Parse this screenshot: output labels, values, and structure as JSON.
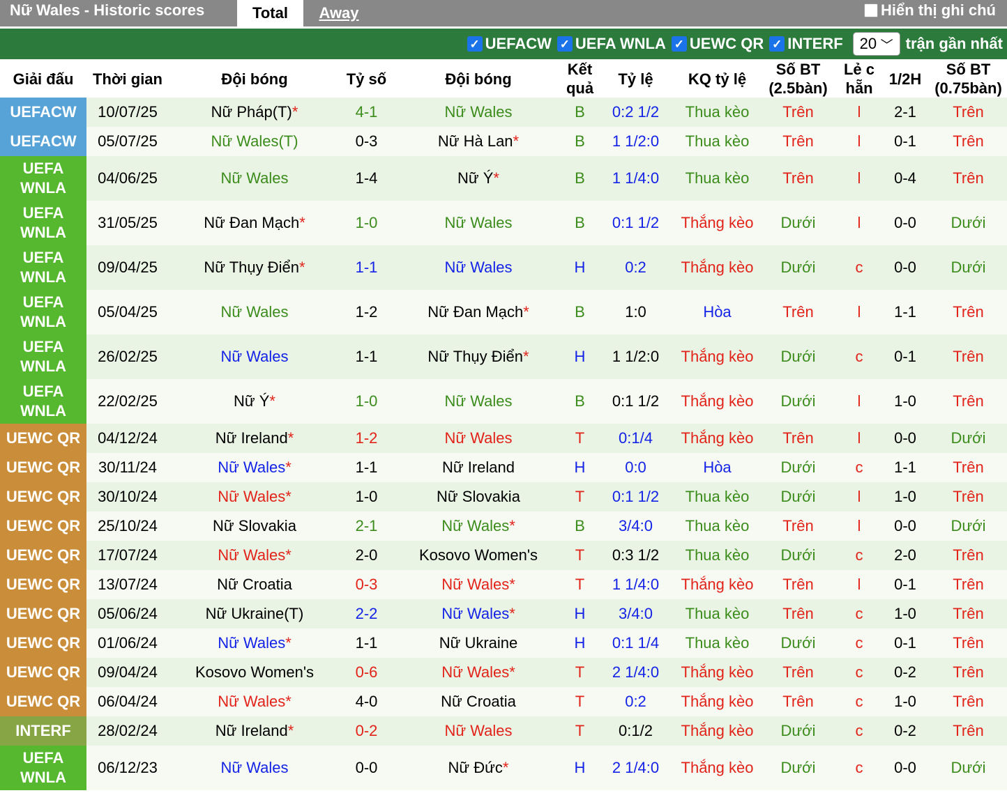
{
  "header": {
    "title": "Nữ Wales - Historic scores",
    "tab_total": "Total",
    "tab_away": "Away",
    "note_label": "Hiển thị ghi chú"
  },
  "filters": {
    "items": [
      "UEFACW",
      "UEFA WNLA",
      "UEWC QR",
      "INTERF"
    ],
    "count_value": "20",
    "count_suffix": "trận gần nhất"
  },
  "columns": [
    "Giải đấu",
    "Thời gian",
    "Đội bóng",
    "Tỷ số",
    "Đội bóng",
    "Kết quả",
    "Tỷ lệ",
    "KQ tỷ lệ",
    "Số BT (2.5bàn)",
    "Lẻ c hẵn",
    "1/2H",
    "Số BT (0.75bàn)"
  ],
  "colors": {
    "red": "#e2231a",
    "green": "#3c8c1c",
    "blue": "#1423e6",
    "black": "#000000",
    "uefacw": "#57a2d6",
    "wnla": "#55b82e",
    "uewc": "#ca8e3a",
    "interf": "#87a544"
  },
  "rows": [
    {
      "comp": "UEFACW",
      "ct": "uefacw",
      "date": "10/07/25",
      "home": "Nữ Pháp(T)",
      "hs": true,
      "hc": "black",
      "score": "4-1",
      "ac": "green",
      "away": "Nữ Wales",
      "as": false,
      "res": "B",
      "rc": "green",
      "odds": "0:2 1/2",
      "oc": "blue",
      "ko": "Thua kèo",
      "kc": "green",
      "ou": "Trên",
      "uc": "red",
      "oe": "l",
      "h2": "2-1",
      "ou2": "Trên",
      "u2c": "red"
    },
    {
      "comp": "UEFACW",
      "ct": "uefacw",
      "date": "05/07/25",
      "home": "Nữ Wales(T)",
      "hs": false,
      "hc": "green",
      "score": "0-3",
      "ac": "black",
      "away": "Nữ Hà Lan",
      "as": true,
      "res": "B",
      "rc": "green",
      "odds": "1 1/2:0",
      "oc": "blue",
      "ko": "Thua kèo",
      "kc": "green",
      "ou": "Trên",
      "uc": "red",
      "oe": "l",
      "h2": "0-1",
      "ou2": "Trên",
      "u2c": "red"
    },
    {
      "comp": "UEFA WNLA",
      "ct": "wnla",
      "date": "04/06/25",
      "home": "Nữ Wales",
      "hs": false,
      "hc": "green",
      "score": "1-4",
      "ac": "black",
      "away": "Nữ Ý",
      "as": true,
      "res": "B",
      "rc": "green",
      "odds": "1 1/4:0",
      "oc": "blue",
      "ko": "Thua kèo",
      "kc": "green",
      "ou": "Trên",
      "uc": "red",
      "oe": "l",
      "h2": "0-4",
      "ou2": "Trên",
      "u2c": "red"
    },
    {
      "comp": "UEFA WNLA",
      "ct": "wnla",
      "date": "31/05/25",
      "home": "Nữ Đan Mạch",
      "hs": true,
      "hc": "black",
      "score": "1-0",
      "ac": "green",
      "away": "Nữ Wales",
      "as": false,
      "res": "B",
      "rc": "green",
      "odds": "0:1 1/2",
      "oc": "blue",
      "ko": "Thắng kèo",
      "kc": "red",
      "ou": "Dưới",
      "uc": "green",
      "oe": "l",
      "h2": "0-0",
      "ou2": "Dưới",
      "u2c": "green"
    },
    {
      "comp": "UEFA WNLA",
      "ct": "wnla",
      "date": "09/04/25",
      "home": "Nữ Thụy Điển",
      "hs": true,
      "hc": "black",
      "score": "1-1",
      "ac": "blue",
      "away": "Nữ Wales",
      "as": false,
      "res": "H",
      "rc": "blue",
      "odds": "0:2",
      "oc": "blue",
      "ko": "Thắng kèo",
      "kc": "red",
      "ou": "Dưới",
      "uc": "green",
      "oe": "c",
      "h2": "0-0",
      "ou2": "Dưới",
      "u2c": "green"
    },
    {
      "comp": "UEFA WNLA",
      "ct": "wnla",
      "date": "05/04/25",
      "home": "Nữ Wales",
      "hs": false,
      "hc": "green",
      "score": "1-2",
      "ac": "black",
      "away": "Nữ Đan Mạch",
      "as": true,
      "res": "B",
      "rc": "green",
      "odds": "1:0",
      "oc": "black",
      "ko": "Hòa",
      "kc": "blue",
      "ou": "Trên",
      "uc": "red",
      "oe": "l",
      "h2": "1-1",
      "ou2": "Trên",
      "u2c": "red"
    },
    {
      "comp": "UEFA WNLA",
      "ct": "wnla",
      "date": "26/02/25",
      "home": "Nữ Wales",
      "hs": false,
      "hc": "blue",
      "score": "1-1",
      "ac": "black",
      "away": "Nữ Thụy Điển",
      "as": true,
      "res": "H",
      "rc": "blue",
      "odds": "1 1/2:0",
      "oc": "black",
      "ko": "Thắng kèo",
      "kc": "red",
      "ou": "Dưới",
      "uc": "green",
      "oe": "c",
      "h2": "0-1",
      "ou2": "Trên",
      "u2c": "red"
    },
    {
      "comp": "UEFA WNLA",
      "ct": "wnla",
      "date": "22/02/25",
      "home": "Nữ Ý",
      "hs": true,
      "hc": "black",
      "score": "1-0",
      "ac": "green",
      "away": "Nữ Wales",
      "as": false,
      "res": "B",
      "rc": "green",
      "odds": "0:1 1/2",
      "oc": "black",
      "ko": "Thắng kèo",
      "kc": "red",
      "ou": "Dưới",
      "uc": "green",
      "oe": "l",
      "h2": "1-0",
      "ou2": "Trên",
      "u2c": "red"
    },
    {
      "comp": "UEWC QR",
      "ct": "uewc",
      "date": "04/12/24",
      "home": "Nữ Ireland",
      "hs": true,
      "hc": "black",
      "score": "1-2",
      "ac": "red",
      "away": "Nữ Wales",
      "as": false,
      "res": "T",
      "rc": "red",
      "odds": "0:1/4",
      "oc": "blue",
      "ko": "Thắng kèo",
      "kc": "red",
      "ou": "Trên",
      "uc": "red",
      "oe": "l",
      "h2": "0-0",
      "ou2": "Dưới",
      "u2c": "green"
    },
    {
      "comp": "UEWC QR",
      "ct": "uewc",
      "date": "30/11/24",
      "home": "Nữ Wales",
      "hs": true,
      "hc": "blue",
      "score": "1-1",
      "ac": "black",
      "away": "Nữ Ireland",
      "as": false,
      "res": "H",
      "rc": "blue",
      "odds": "0:0",
      "oc": "blue",
      "ko": "Hòa",
      "kc": "blue",
      "ou": "Dưới",
      "uc": "green",
      "oe": "c",
      "h2": "1-1",
      "ou2": "Trên",
      "u2c": "red"
    },
    {
      "comp": "UEWC QR",
      "ct": "uewc",
      "date": "30/10/24",
      "home": "Nữ Wales",
      "hs": true,
      "hc": "red",
      "score": "1-0",
      "ac": "black",
      "away": "Nữ Slovakia",
      "as": false,
      "res": "T",
      "rc": "red",
      "odds": "0:1 1/2",
      "oc": "blue",
      "ko": "Thua kèo",
      "kc": "green",
      "ou": "Dưới",
      "uc": "green",
      "oe": "l",
      "h2": "1-0",
      "ou2": "Trên",
      "u2c": "red"
    },
    {
      "comp": "UEWC QR",
      "ct": "uewc",
      "date": "25/10/24",
      "home": "Nữ Slovakia",
      "hs": false,
      "hc": "black",
      "score": "2-1",
      "ac": "green",
      "away": "Nữ Wales",
      "as": true,
      "res": "B",
      "rc": "green",
      "odds": "3/4:0",
      "oc": "blue",
      "ko": "Thua kèo",
      "kc": "green",
      "ou": "Trên",
      "uc": "red",
      "oe": "l",
      "h2": "0-0",
      "ou2": "Dưới",
      "u2c": "green"
    },
    {
      "comp": "UEWC QR",
      "ct": "uewc",
      "date": "17/07/24",
      "home": "Nữ Wales",
      "hs": true,
      "hc": "red",
      "score": "2-0",
      "ac": "black",
      "away": "Kosovo Women's",
      "as": false,
      "res": "T",
      "rc": "red",
      "odds": "0:3 1/2",
      "oc": "black",
      "ko": "Thua kèo",
      "kc": "green",
      "ou": "Dưới",
      "uc": "green",
      "oe": "c",
      "h2": "2-0",
      "ou2": "Trên",
      "u2c": "red"
    },
    {
      "comp": "UEWC QR",
      "ct": "uewc",
      "date": "13/07/24",
      "home": "Nữ Croatia",
      "hs": false,
      "hc": "black",
      "score": "0-3",
      "ac": "red",
      "away": "Nữ Wales",
      "as": true,
      "res": "T",
      "rc": "red",
      "odds": "1 1/4:0",
      "oc": "blue",
      "ko": "Thắng kèo",
      "kc": "red",
      "ou": "Trên",
      "uc": "red",
      "oe": "l",
      "h2": "0-1",
      "ou2": "Trên",
      "u2c": "red"
    },
    {
      "comp": "UEWC QR",
      "ct": "uewc",
      "date": "05/06/24",
      "home": "Nữ Ukraine(T)",
      "hs": false,
      "hc": "black",
      "score": "2-2",
      "ac": "blue",
      "away": "Nữ Wales",
      "as": true,
      "res": "H",
      "rc": "blue",
      "odds": "3/4:0",
      "oc": "blue",
      "ko": "Thua kèo",
      "kc": "green",
      "ou": "Trên",
      "uc": "red",
      "oe": "c",
      "h2": "1-0",
      "ou2": "Trên",
      "u2c": "red"
    },
    {
      "comp": "UEWC QR",
      "ct": "uewc",
      "date": "01/06/24",
      "home": "Nữ Wales",
      "hs": true,
      "hc": "blue",
      "score": "1-1",
      "ac": "black",
      "away": "Nữ Ukraine",
      "as": false,
      "res": "H",
      "rc": "blue",
      "odds": "0:1 1/4",
      "oc": "blue",
      "ko": "Thua kèo",
      "kc": "green",
      "ou": "Dưới",
      "uc": "green",
      "oe": "c",
      "h2": "0-1",
      "ou2": "Trên",
      "u2c": "red"
    },
    {
      "comp": "UEWC QR",
      "ct": "uewc",
      "date": "09/04/24",
      "home": "Kosovo Women's",
      "hs": false,
      "hc": "black",
      "score": "0-6",
      "ac": "red",
      "away": "Nữ Wales",
      "as": true,
      "res": "T",
      "rc": "red",
      "odds": "2 1/4:0",
      "oc": "blue",
      "ko": "Thắng kèo",
      "kc": "red",
      "ou": "Trên",
      "uc": "red",
      "oe": "c",
      "h2": "0-2",
      "ou2": "Trên",
      "u2c": "red"
    },
    {
      "comp": "UEWC QR",
      "ct": "uewc",
      "date": "06/04/24",
      "home": "Nữ Wales",
      "hs": true,
      "hc": "red",
      "score": "4-0",
      "ac": "black",
      "away": "Nữ Croatia",
      "as": false,
      "res": "T",
      "rc": "red",
      "odds": "0:2",
      "oc": "blue",
      "ko": "Thắng kèo",
      "kc": "red",
      "ou": "Trên",
      "uc": "red",
      "oe": "c",
      "h2": "1-0",
      "ou2": "Trên",
      "u2c": "red"
    },
    {
      "comp": "INTERF",
      "ct": "interf",
      "date": "28/02/24",
      "home": "Nữ Ireland",
      "hs": true,
      "hc": "black",
      "score": "0-2",
      "ac": "red",
      "away": "Nữ Wales",
      "as": false,
      "res": "T",
      "rc": "red",
      "odds": "0:1/2",
      "oc": "black",
      "ko": "Thắng kèo",
      "kc": "red",
      "ou": "Dưới",
      "uc": "green",
      "oe": "c",
      "h2": "0-2",
      "ou2": "Trên",
      "u2c": "red"
    },
    {
      "comp": "UEFA WNLA",
      "ct": "wnla",
      "date": "06/12/23",
      "home": "Nữ Wales",
      "hs": false,
      "hc": "blue",
      "score": "0-0",
      "ac": "black",
      "away": "Nữ Đức",
      "as": true,
      "res": "H",
      "rc": "blue",
      "odds": "2 1/4:0",
      "oc": "blue",
      "ko": "Thắng kèo",
      "kc": "red",
      "ou": "Dưới",
      "uc": "green",
      "oe": "c",
      "h2": "0-0",
      "ou2": "Dưới",
      "u2c": "green"
    }
  ]
}
